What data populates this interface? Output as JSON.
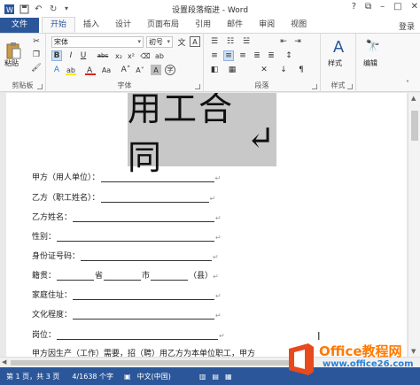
{
  "window": {
    "title": "设置段落缩进 - Word",
    "controls": [
      "?",
      "⧉",
      "–",
      "□",
      "✕"
    ]
  },
  "tabs": {
    "items": [
      "文件",
      "开始",
      "插入",
      "设计",
      "页面布局",
      "引用",
      "邮件",
      "审阅",
      "视图"
    ],
    "login": "登录"
  },
  "ribbon": {
    "clipboard": {
      "label": "剪贴板",
      "paste": "粘贴"
    },
    "font": {
      "label": "字体",
      "font_name": "宋体",
      "font_size": "初号",
      "wen": "文",
      "A": "A"
    },
    "paragraph": {
      "label": "段落"
    },
    "styles": {
      "label": "样式",
      "style_btn": "样式"
    },
    "editing": {
      "label": "编辑"
    }
  },
  "document": {
    "heading": "用工合同",
    "lines": [
      {
        "label": "甲方（用人单位）：",
        "tail": "↵"
      },
      {
        "label": "乙方（职工姓名）：",
        "tail": "↵"
      },
      {
        "label": "乙方姓名：",
        "tail": "↵"
      },
      {
        "label": "性别：",
        "tail": "↵"
      },
      {
        "label": "身份证号码：",
        "tail": "↵"
      },
      {
        "label": "籍贯：",
        "p1": "省",
        "p2": "市",
        "p3": "（县）",
        "tail": "↵"
      },
      {
        "label": "家庭住址：",
        "tail": "↵"
      },
      {
        "label": "文化程度：",
        "tail": "↵"
      },
      {
        "label": "岗位：",
        "tail": "↵"
      },
      {
        "label": "甲方因生产（工作）需要，招（聘）用乙方为本单位职工，甲方"
      }
    ]
  },
  "statusbar": {
    "page": "第 1 页，共 3 页",
    "words": "4/1638 个字",
    "lang": "中文(中国)"
  },
  "watermark": {
    "brand": "Office教程网",
    "url": "www.office26.com"
  }
}
